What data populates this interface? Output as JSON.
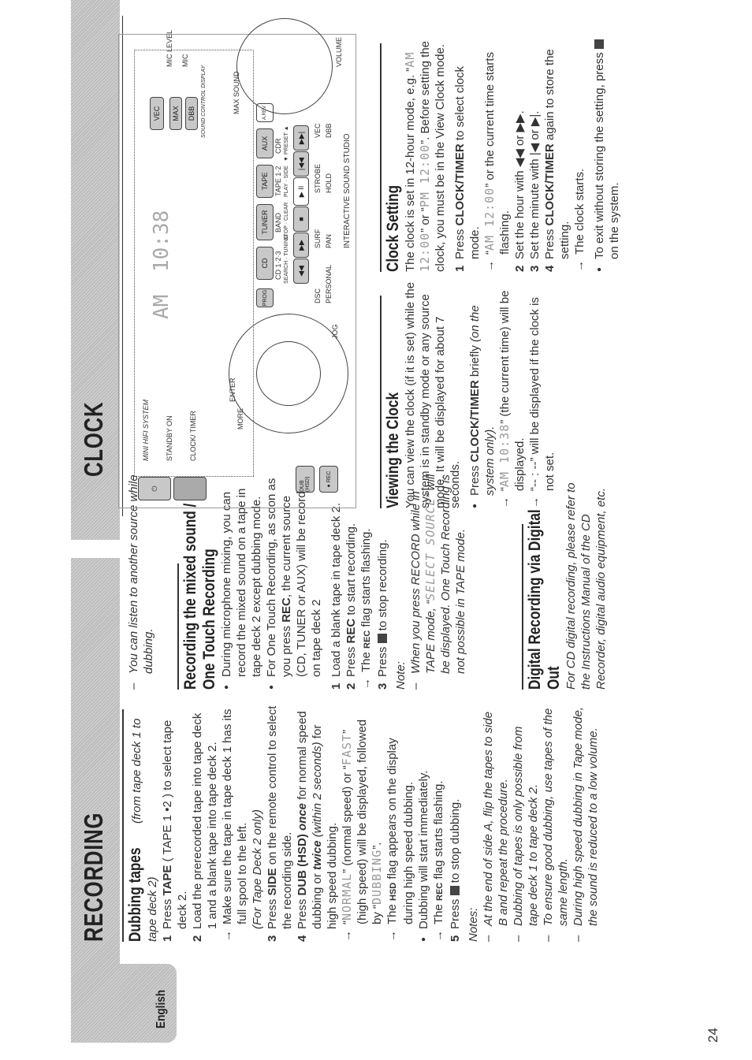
{
  "page": {
    "language_tab": "English",
    "page_number": "24"
  },
  "sections": {
    "recording_title": "RECORDING",
    "clock_title": "CLOCK"
  },
  "dubbing": {
    "heading": "Dubbing tapes",
    "heading_sub": "(from tape deck 1 to tape deck 2)",
    "step1_a": "Press ",
    "step1_b": "TAPE",
    "step1_c": " ( TAPE 1 •2 ) to select tape deck 2.",
    "step2": "Load the prerecorded tape into tape deck 1 and a blank tape into tape deck 2.",
    "step2_arrow": "Make sure the tape in tape deck 1 has its full spool to the left.",
    "step3_note": "(For Tape Deck 2 only)",
    "step3_a": "Press ",
    "step3_b": "SIDE",
    "step3_c": " on the remote control to select the recording side.",
    "step4_a": "Press ",
    "step4_b": "DUB (HSD)",
    "step4_c": " once",
    "step4_d": " for normal speed dubbing or ",
    "step4_e": "twice",
    "step4_f": " (within 2 seconds)",
    "step4_g": " for high speed dubbing.",
    "step4_arrow1_lcd1": "NORMAL",
    "step4_arrow1_a": " (normal speed) or ",
    "step4_arrow1_lcd2": "FAST",
    "step4_arrow1_b": " (high speed) will be displayed, followed by ",
    "step4_arrow1_lcd3": "DUBBING",
    "step4_arrow2_a": "The ",
    "step4_arrow2_flag": "HSD",
    "step4_arrow2_b": " flag appears on the display during high speed dubbing.",
    "bullet_start": "Dubbing will start immediately.",
    "bullet_arrow_a": "The ",
    "bullet_arrow_flag": "REC",
    "bullet_arrow_b": " flag starts flashing.",
    "step5_a": "Press ",
    "step5_b": " to stop dubbing.",
    "notes_label": "Notes:",
    "notes": [
      "At the end of side A, flip the tapes to side B and repeat the procedure.",
      "Dubbing of tapes is only possible from tape deck 1 to tape deck 2.",
      "To ensure good dubbing, use tapes of the same length.",
      "During high speed dubbing in Tape mode, the sound is reduced to a low volume."
    ],
    "listen_note": "You can listen to another source while dubbing."
  },
  "mixed": {
    "heading_line1": "Recording the mixed sound /",
    "heading_line2": "One Touch Recording",
    "bullet1": "During microphone mixing, you can record the mixed sound on a tape in tape deck 2 except dubbing mode.",
    "bullet2_a": "For One Touch Recording, as soon as you press ",
    "bullet2_b": "REC",
    "bullet2_c": ", the current source (CD, TUNER or AUX) will be recorded on tape deck 2",
    "step1": "Load a blank tape in tape deck 2.",
    "step2_a": "Press ",
    "step2_b": "REC",
    "step2_c": " to start recording.",
    "step2_arrow_a": "The ",
    "step2_arrow_flag": "REC",
    "step2_arrow_b": " flag starts flashing.",
    "step3_a": "Press ",
    "step3_b": " to stop recording.",
    "note_label": "Note:",
    "note_a": "When you press RECORD while in TAPE mode, ",
    "note_lcd": "SELECT SOURCE",
    "note_b": " will be displayed.  One Touch Recording is not possible in TAPE mode."
  },
  "digital": {
    "heading_line1": "Digital Recording via Digital",
    "heading_line2": "Out",
    "body": "For CD digital recording, please refer to the Instructions Manual of the CD Recorder, digital audio equipment, etc."
  },
  "viewing": {
    "heading": "Viewing the Clock",
    "body": "You can view the clock (if it is set) while the system is in standby mode or any source mode. It will be displayed for about 7 seconds.",
    "bullet_a": "Press ",
    "bullet_b": "CLOCK/TIMER",
    "bullet_c": " briefly ",
    "bullet_d": "(on the system only).",
    "arrow1_lcd": "AM 10:38",
    "arrow1_b": " (the current time) will be displayed.",
    "arrow2_lcd": "-- : --",
    "arrow2_b": " will be displayed if the clock is not set."
  },
  "setting": {
    "heading": "Clock Setting",
    "body_a": "The clock is set in 12-hour mode, e.g. ",
    "body_lcd1": "AM 12:00",
    "body_b": " or ",
    "body_lcd2": "PM 12:00",
    "body_c": ". Before setting the clock, you must be in the View Clock mode.",
    "step1_a": "Press ",
    "step1_b": "CLOCK/TIMER",
    "step1_c": " to select clock mode.",
    "step1_arrow_lcd": "AM 12:00",
    "step1_arrow_b": " or the current time starts flashing.",
    "step2": "Set the hour with ◀◀ or ▶▶.",
    "step3": "Set the minute with |◀ or ▶|.",
    "step4_a": "Press ",
    "step4_b": "CLOCK/TIMER",
    "step4_c": " again to store the setting.",
    "step4_arrow": "The clock starts.",
    "bullet_a": "To exit without storing the setting, press ",
    "bullet_b": " on the system."
  },
  "device": {
    "standby": "STANDBY ON",
    "clock_timer": "CLOCK/ TIMER",
    "mini_hifi": "MINI HIFI SYSTEM",
    "lcd_am": "AM",
    "lcd_time": "10:38",
    "buttons": [
      "PROG",
      "CD",
      "TUNER",
      "TAPE",
      "AUX"
    ],
    "sublabels": [
      "CD 1·2·3",
      "BAND",
      "TAPE 1·2",
      "CDR"
    ],
    "transport_labels": [
      "SEARCH · TUNING",
      "STOP · CLEAR",
      "PLAY · SIDE",
      "▼ PRESET ▲"
    ],
    "transport": [
      "◀◀",
      "▶▶",
      "■",
      "▶ II",
      "|◀◀",
      "▶▶|"
    ],
    "a_rev": "A.REV",
    "sound_buttons": [
      "VEC",
      "MAX",
      "DBB"
    ],
    "sound_control": "SOUND CONTROL DISPLAY",
    "dsc_pads": [
      "DSC",
      "PERSONAL"
    ],
    "dj_pads": [
      "SURF",
      "PAN",
      "STROBE",
      "HOLD"
    ],
    "vec_dbb_pads": [
      "VEC",
      "DBB"
    ],
    "jog_labels": [
      "MORE",
      "ENTER",
      "JOG"
    ],
    "dub_rec": [
      "DUB (HSD)",
      "● REC"
    ],
    "volume": "VOLUME",
    "max_sound": "MAX SOUND",
    "mic": [
      "MIC LEVEL",
      "MIC"
    ],
    "studio": "INTERACTIVE SOUND STUDIO"
  }
}
